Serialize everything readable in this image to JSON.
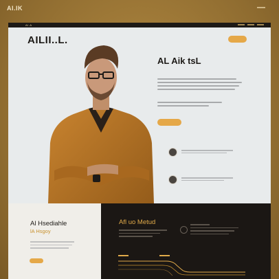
{
  "outer": {
    "logo": "AI.IK"
  },
  "topbar": {
    "label": "ΑΙ.Α"
  },
  "header": {
    "brand": "AILII..L."
  },
  "hero": {
    "title": "AL Aik tsL"
  },
  "colors": {
    "accent": "#e5a848",
    "dark": "#1b1714",
    "page_bg": "#e8ebec",
    "outer_bg": "#9a7737"
  },
  "bottom_left": {
    "title": "Al Hsediahle",
    "subtitle": "lA Hsgoy"
  },
  "bottom_right": {
    "title": "Afl uo Metud"
  }
}
